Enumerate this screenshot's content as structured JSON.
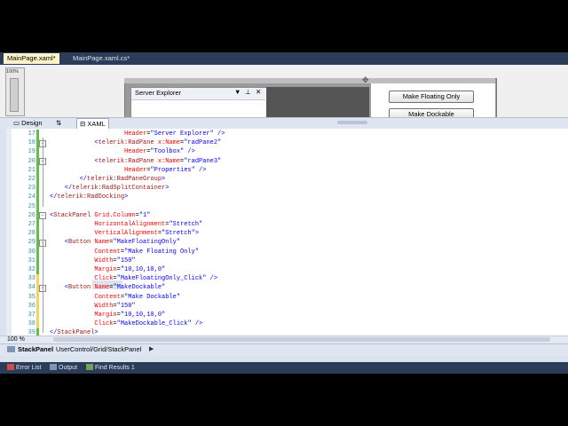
{
  "document_tabs": [
    {
      "label": "MainPage.xaml*",
      "active": true
    },
    {
      "label": "MainPage.xaml.cs*",
      "active": false
    }
  ],
  "designer": {
    "zoom_label": "100%",
    "pane_title": "Server Explorer",
    "pane_icons": [
      "pin-dropdown",
      "pin",
      "close"
    ],
    "buttons": [
      "Make Floating Only",
      "Make Dockable"
    ]
  },
  "split_tabs": [
    {
      "label": "Design",
      "selected": false
    },
    {
      "label": "⇅",
      "selected": false
    },
    {
      "label": "XAML",
      "selected": true
    }
  ],
  "editor": {
    "lines": [
      {
        "n": "17",
        "segs": [
          [
            "at",
            "                    Header"
          ],
          [
            "tx",
            "="
          ],
          [
            "va",
            "\"Server Explorer\""
          ],
          [
            "brk",
            " />"
          ]
        ]
      },
      {
        "n": "18",
        "segs": [
          [
            "brk",
            "            <"
          ],
          [
            "el",
            "telerik:RadPane"
          ],
          [
            "at",
            " x:Name"
          ],
          [
            "tx",
            "="
          ],
          [
            "va",
            "\"radPane2\""
          ]
        ]
      },
      {
        "n": "19",
        "segs": [
          [
            "at",
            "                    Header"
          ],
          [
            "tx",
            "="
          ],
          [
            "va",
            "\"Toolbox\""
          ],
          [
            "brk",
            " />"
          ]
        ]
      },
      {
        "n": "20",
        "segs": [
          [
            "brk",
            "            <"
          ],
          [
            "el",
            "telerik:RadPane"
          ],
          [
            "at",
            " x:Name"
          ],
          [
            "tx",
            "="
          ],
          [
            "va",
            "\"radPane3\""
          ]
        ]
      },
      {
        "n": "21",
        "segs": [
          [
            "at",
            "                    Header"
          ],
          [
            "tx",
            "="
          ],
          [
            "va",
            "\"Properties\""
          ],
          [
            "brk",
            " />"
          ]
        ]
      },
      {
        "n": "22",
        "segs": [
          [
            "brk",
            "        </"
          ],
          [
            "el",
            "telerik:RadPaneGroup"
          ],
          [
            "brk",
            ">"
          ]
        ]
      },
      {
        "n": "23",
        "segs": [
          [
            "brk",
            "    </"
          ],
          [
            "el",
            "telerik:RadSplitContainer"
          ],
          [
            "brk",
            ">"
          ]
        ]
      },
      {
        "n": "24",
        "segs": [
          [
            "brk",
            "</"
          ],
          [
            "el",
            "telerik:RadDocking"
          ],
          [
            "brk",
            ">"
          ]
        ]
      },
      {
        "n": "25",
        "segs": []
      },
      {
        "n": "26",
        "segs": [
          [
            "brk",
            "<"
          ],
          [
            "el",
            "StackPanel"
          ],
          [
            "at",
            " Grid.Column"
          ],
          [
            "tx",
            "="
          ],
          [
            "va",
            "\"1\""
          ]
        ]
      },
      {
        "n": "27",
        "segs": [
          [
            "at",
            "            HorizontalAlignment"
          ],
          [
            "tx",
            "="
          ],
          [
            "va",
            "\"Stretch\""
          ]
        ]
      },
      {
        "n": "28",
        "segs": [
          [
            "at",
            "            VerticalAlignment"
          ],
          [
            "tx",
            "="
          ],
          [
            "va",
            "\"Stretch\""
          ],
          [
            "brk",
            ">"
          ]
        ]
      },
      {
        "n": "29",
        "segs": [
          [
            "brk",
            "    <"
          ],
          [
            "el",
            "Button"
          ],
          [
            "at",
            " Name"
          ],
          [
            "tx",
            "="
          ],
          [
            "va",
            "\"MakeFloatingOnly\""
          ]
        ]
      },
      {
        "n": "30",
        "segs": [
          [
            "at",
            "            Content"
          ],
          [
            "tx",
            "="
          ],
          [
            "va",
            "\"Make Floating Only\""
          ]
        ]
      },
      {
        "n": "31",
        "segs": [
          [
            "at",
            "            Width"
          ],
          [
            "tx",
            "="
          ],
          [
            "va",
            "\"150\""
          ]
        ]
      },
      {
        "n": "32",
        "segs": [
          [
            "at",
            "            Margin"
          ],
          [
            "tx",
            "="
          ],
          [
            "va",
            "\"10,10,10,0\""
          ]
        ]
      },
      {
        "n": "33",
        "segs": [
          [
            "at",
            "            Click"
          ],
          [
            "tx",
            "="
          ],
          [
            "va",
            "\"MakeFloatingOnly_Click\""
          ],
          [
            "brk",
            " />"
          ]
        ]
      },
      {
        "n": "34",
        "segs": [
          [
            "brk",
            "    <"
          ],
          [
            "el",
            "Button"
          ],
          [
            "at",
            " Name"
          ],
          [
            "tx",
            "="
          ],
          [
            "va",
            "\"MakeDockable\""
          ]
        ]
      },
      {
        "n": "35",
        "segs": [
          [
            "at",
            "            Content"
          ],
          [
            "tx",
            "="
          ],
          [
            "va",
            "\"Make Dockable\""
          ]
        ]
      },
      {
        "n": "36",
        "segs": [
          [
            "at",
            "            Width"
          ],
          [
            "tx",
            "="
          ],
          [
            "va",
            "\"150\""
          ]
        ]
      },
      {
        "n": "37",
        "segs": [
          [
            "at",
            "            Margin"
          ],
          [
            "tx",
            "="
          ],
          [
            "va",
            "\"10,10,10,0\""
          ]
        ]
      },
      {
        "n": "38",
        "segs": [
          [
            "at",
            "            Click"
          ],
          [
            "tx",
            "="
          ],
          [
            "va",
            "\"MakeDockable_Click\""
          ],
          [
            "brk",
            " />"
          ]
        ]
      },
      {
        "n": "39",
        "segs": [
          [
            "brk",
            "</"
          ],
          [
            "el",
            "StackPanel"
          ],
          [
            "brk",
            ">"
          ]
        ]
      }
    ]
  },
  "status": {
    "zoom": "100 %",
    "breadcrumb_root": "StackPanel",
    "breadcrumb_path": "UserControl/Grid/StackPanel",
    "breadcrumb_arrow": "▶"
  },
  "bottom_tabs": [
    "Error List",
    "Output",
    "Find Results 1"
  ],
  "colors": {
    "element": "#a31515",
    "attribute": "#ff0000",
    "value": "#0000ff",
    "line_number": "#2b91af",
    "changed_saved": "#5fbf4a",
    "changed_unsaved": "#f4d35e"
  }
}
